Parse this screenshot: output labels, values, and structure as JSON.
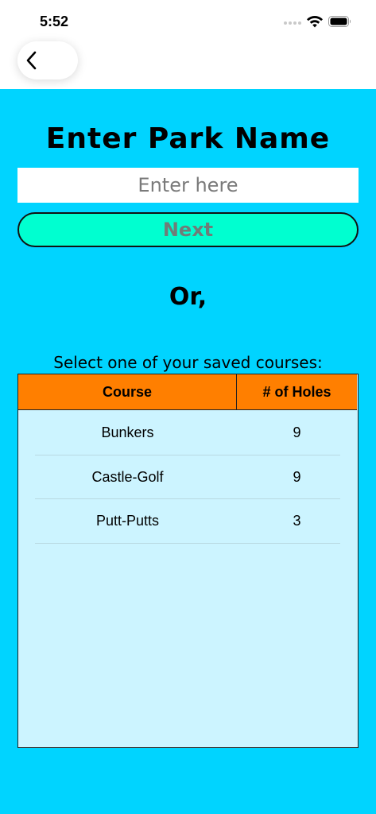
{
  "status_bar": {
    "time": "5:52"
  },
  "nav": {
    "back_icon": "chevron-left-icon"
  },
  "page": {
    "title": "Enter Park Name",
    "input_placeholder": "Enter here",
    "input_value": "",
    "next_label": "Next",
    "or_text": "Or,",
    "select_label": "Select one of your saved courses:"
  },
  "table": {
    "headers": [
      "Course",
      "# of Holes"
    ],
    "rows": [
      {
        "course": "Bunkers",
        "holes": "9"
      },
      {
        "course": "Castle-Golf",
        "holes": "9"
      },
      {
        "course": "Putt-Putts",
        "holes": "3"
      }
    ]
  },
  "colors": {
    "background": "#00d4ff",
    "next_button": "#00ffd0",
    "table_header": "#ff7f00",
    "table_body": "#ccf4ff"
  }
}
